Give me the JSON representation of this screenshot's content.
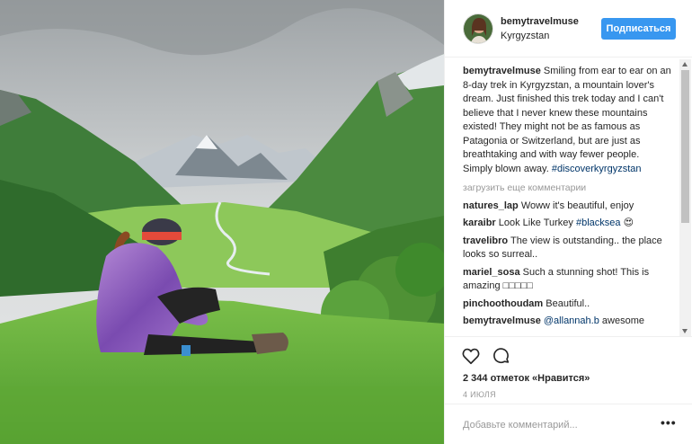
{
  "post": {
    "username": "bemytravelmuse",
    "location": "Kyrgyzstan",
    "follow_label": "Подписаться"
  },
  "caption": {
    "username": "bemytravelmuse",
    "text": "Smiling from ear to ear on an 8-day trek in Kyrgyzstan, a mountain lover's dream. Just finished this trek today and I can't believe that I never knew these mountains existed! They might not be as famous as Patagonia or Switzerland, but are just as breathtaking and with way fewer people. Simply blown away.",
    "hashtag": "#discoverkyrgyzstan"
  },
  "load_more_label": "загрузить еще комментарии",
  "comments": [
    {
      "username": "natures_lap",
      "text": "Woww it's beautiful, enjoy"
    },
    {
      "username": "karaibr",
      "text": "Look Like Turkey",
      "tag": "#blacksea",
      "emoji": "😍"
    },
    {
      "username": "travelibro",
      "text": "The view is outstanding.. the place looks so surreal.."
    },
    {
      "username": "mariel_sosa",
      "text": "Such a stunning shot! This is amazing",
      "emoji": "□□□□□"
    },
    {
      "username": "pinchoothoudam",
      "text": "Beautiful.."
    },
    {
      "username": "bemytravelmuse",
      "mention": "@allannah.b",
      "text": "awesome"
    }
  ],
  "actions": {
    "like_icon": "heart-icon",
    "comment_icon": "comment-icon",
    "likes_text": "2 344 отметок «Нравится»",
    "date": "4 ИЮЛЯ"
  },
  "add_comment": {
    "placeholder": "Добавьте комментарий...",
    "more_label": "•••"
  },
  "colors": {
    "accent": "#3897f0",
    "hashtag": "#003569",
    "muted": "#999999"
  }
}
